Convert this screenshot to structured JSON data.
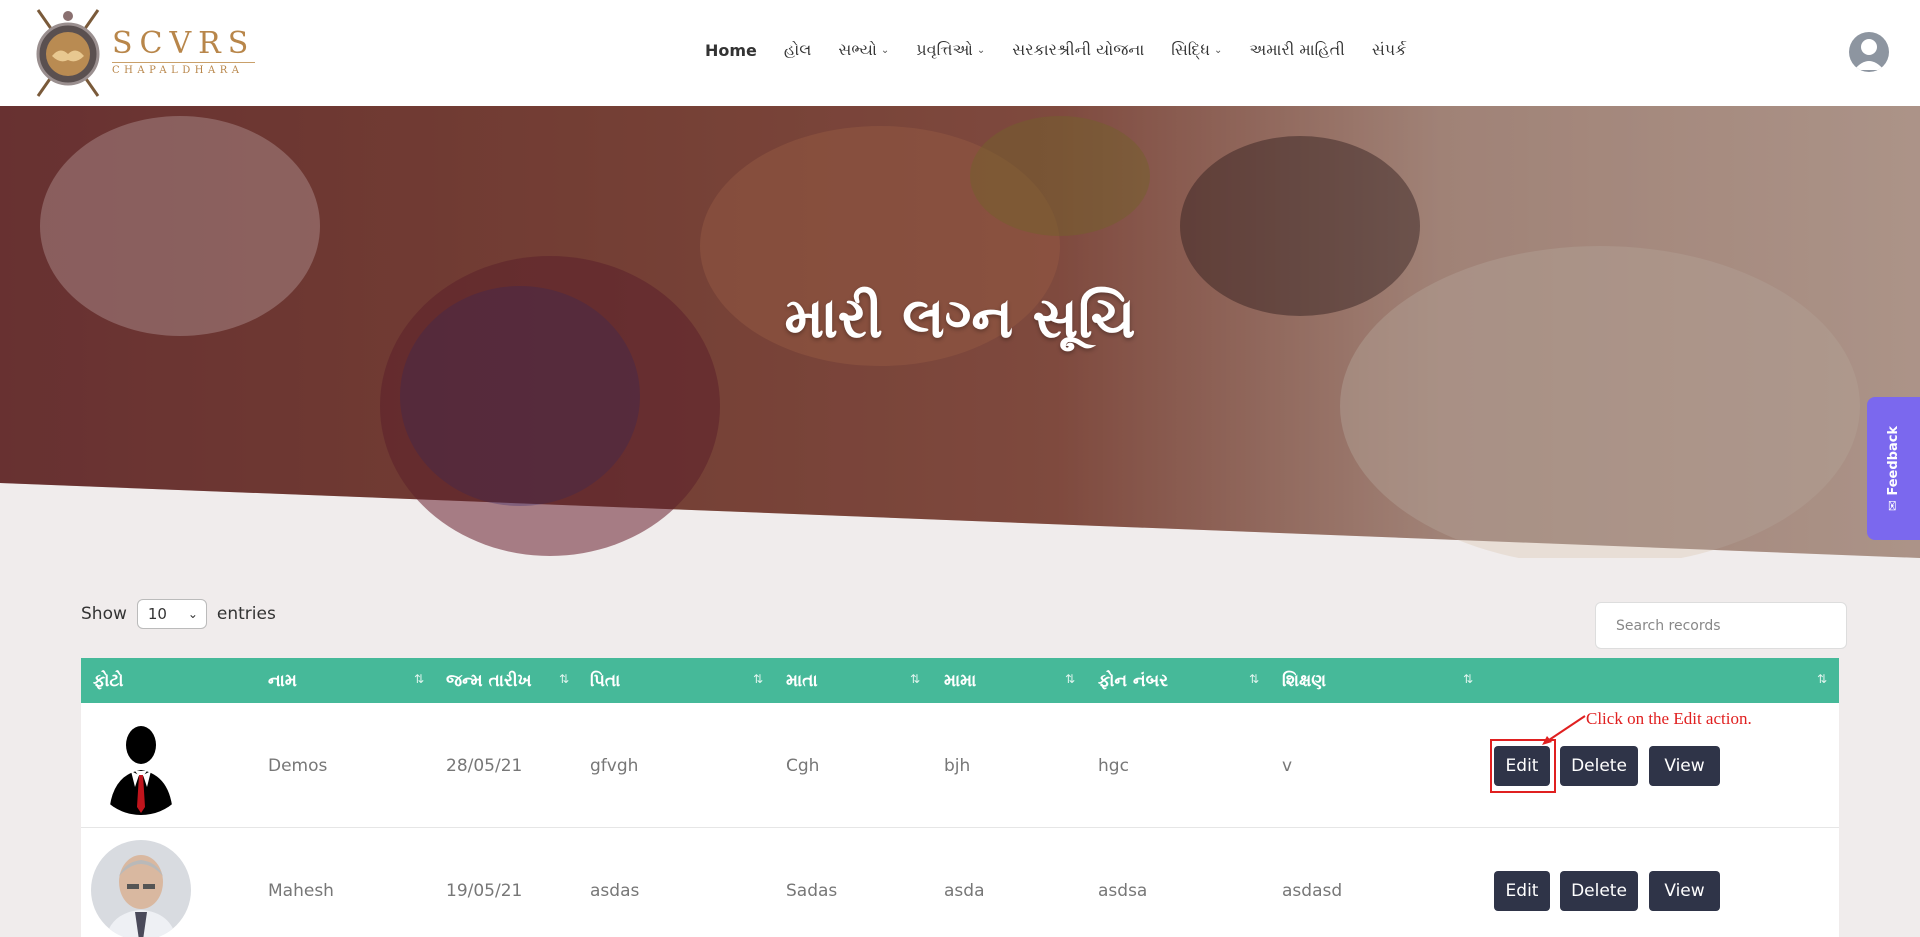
{
  "brand": {
    "name": "SCVRS",
    "sub": "CHAPALDHARA"
  },
  "nav": [
    {
      "label": "Home",
      "active": true,
      "dropdown": false
    },
    {
      "label": "હોલ",
      "active": false,
      "dropdown": false
    },
    {
      "label": "સભ્યો",
      "active": false,
      "dropdown": true
    },
    {
      "label": "પ્રવૃત્તિઓ",
      "active": false,
      "dropdown": true
    },
    {
      "label": "સરકારશ્રીની યોજના",
      "active": false,
      "dropdown": false
    },
    {
      "label": "સિદ્ધિ",
      "active": false,
      "dropdown": true
    },
    {
      "label": "અમારી માહિતી",
      "active": false,
      "dropdown": false
    },
    {
      "label": "સંપર્ક",
      "active": false,
      "dropdown": false
    }
  ],
  "hero": {
    "title": "મારી લગ્ન સૂચિ"
  },
  "feedback": {
    "label": "✉ Feedback"
  },
  "controls": {
    "show_label": "Show",
    "entries_value": "10",
    "entries_label": "entries",
    "search_placeholder": "Search records"
  },
  "table": {
    "headers": [
      "ફોટો",
      "નામ",
      "જન્મ તારીખ",
      "પિતા",
      "માતા",
      "મામા",
      "ફોન નંબર",
      "શિક્ષણ",
      ""
    ],
    "sort_glyph": "⇅",
    "rows": [
      {
        "name": "Demos",
        "dob": "28/05/21",
        "father": "gfvgh",
        "mother": "Cgh",
        "uncle": "bjh",
        "phone": "hgc",
        "education": "v"
      },
      {
        "name": "Mahesh",
        "dob": "19/05/21",
        "father": "asdas",
        "mother": "Sadas",
        "uncle": "asda",
        "phone": "asdsa",
        "education": "asdasd"
      }
    ],
    "actions": {
      "edit": "Edit",
      "delete": "Delete",
      "view": "View"
    }
  },
  "annotation": {
    "text": "Click on the Edit action.",
    "color": "#e02020"
  },
  "colors": {
    "header_bg": "#46b999",
    "button_bg": "#2f3448",
    "feedback_bg": "#7b68ee",
    "page_bg": "#f0ecec"
  }
}
